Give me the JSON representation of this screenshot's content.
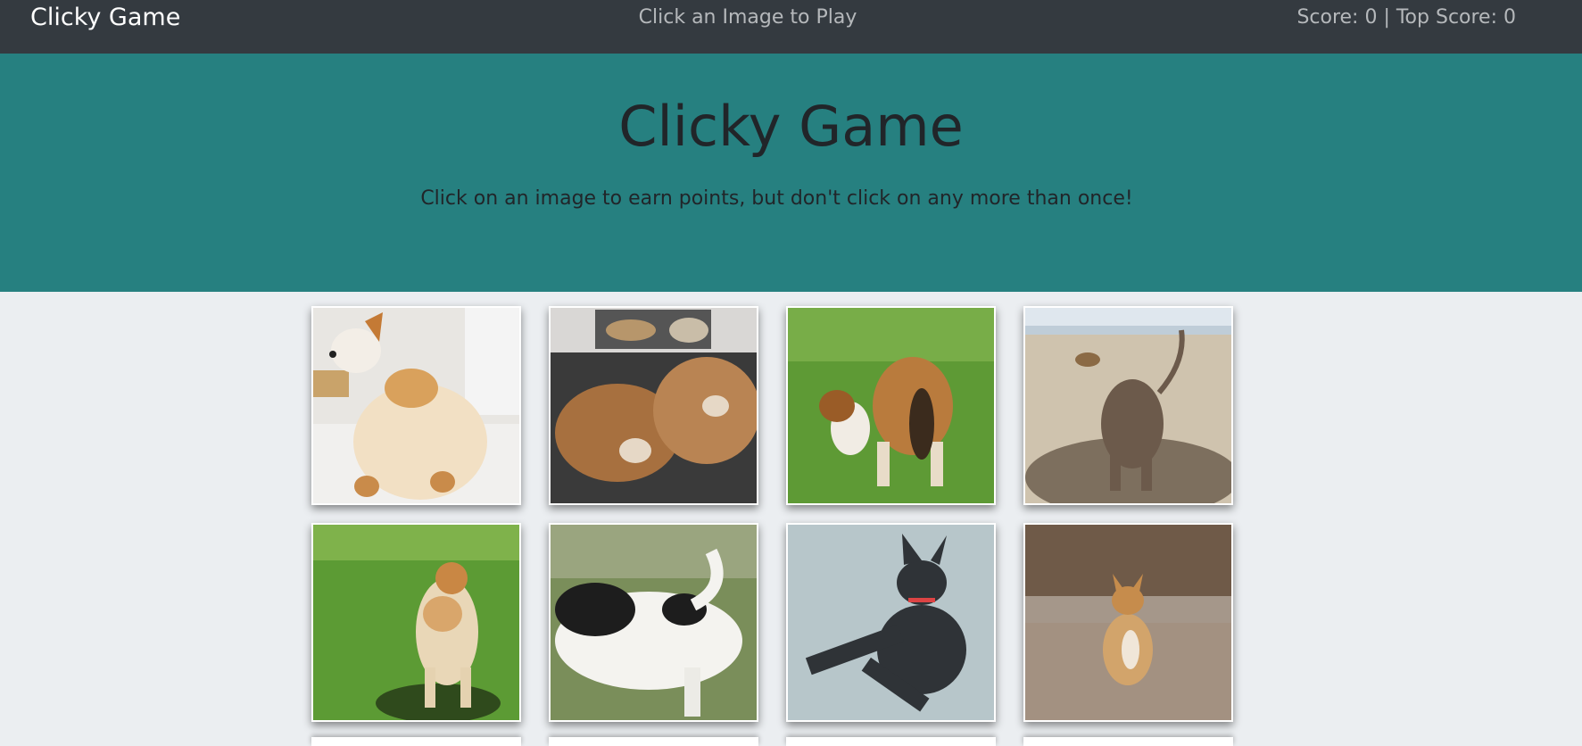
{
  "navbar": {
    "brand": "Clicky Game",
    "message": "Click an Image to Play",
    "score_text": "Score: 0 | Top Score: 0"
  },
  "jumbotron": {
    "title": "Clicky Game",
    "subtitle": "Click on an image to earn points, but don't click on any more than once!"
  },
  "cards": [
    {
      "name": "corgi-heart-butt-image"
    },
    {
      "name": "two-bulldogs-lying-image"
    },
    {
      "name": "collie-on-grass-image"
    },
    {
      "name": "dog-digging-sand-image"
    },
    {
      "name": "shiba-on-grass-image"
    },
    {
      "name": "jack-russell-image"
    },
    {
      "name": "french-bulldog-splits-image"
    },
    {
      "name": "corgi-walking-road-image"
    }
  ],
  "colors": {
    "navbar_bg": "#343a40",
    "jumbotron_bg": "#268080",
    "page_bg": "#ebeef1"
  }
}
